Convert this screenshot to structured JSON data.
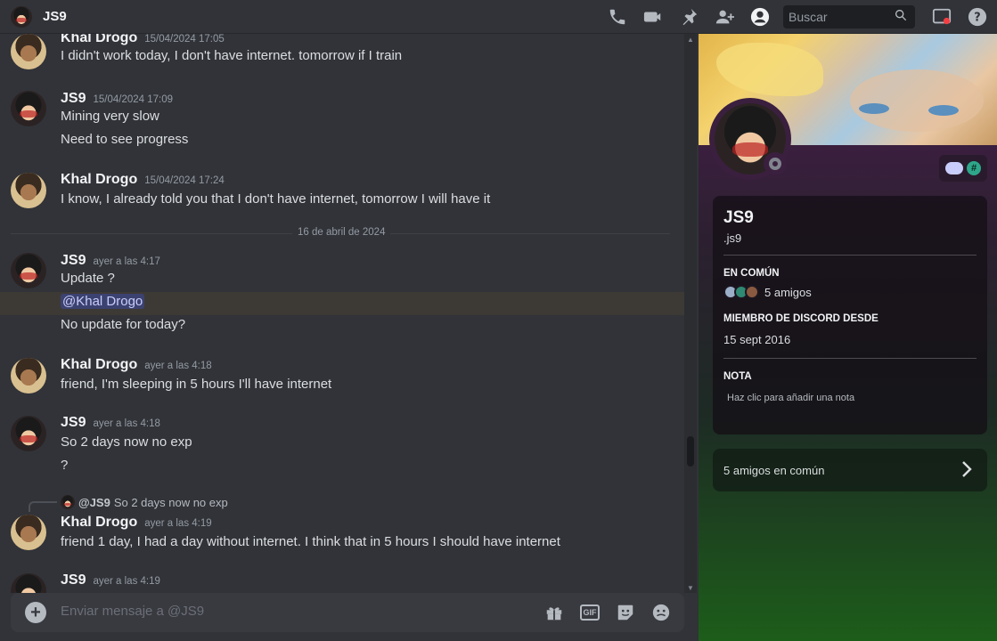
{
  "header": {
    "title": "JS9",
    "search_placeholder": "Buscar"
  },
  "messages": [
    {
      "author": "Khal Drogo",
      "time": "15/04/2024 17:05",
      "lines": [
        "I didn't work today, I don't have internet. tomorrow if I train"
      ]
    },
    {
      "author": "JS9",
      "time": "15/04/2024 17:09",
      "lines": [
        "Mining very slow",
        "Need to see progress"
      ]
    },
    {
      "author": "Khal Drogo",
      "time": "15/04/2024 17:24",
      "lines": [
        "I know, I already told you that I don't have internet, tomorrow I will have it"
      ]
    },
    {
      "author": "JS9",
      "time": "ayer a las 4:17",
      "lines": [
        "Update ?",
        "@Khal Drogo",
        "No update for today?"
      ]
    },
    {
      "author": "Khal Drogo",
      "time": "ayer a las 4:18",
      "lines": [
        "friend, I'm sleeping in 5 hours I'll have internet"
      ]
    },
    {
      "author": "JS9",
      "time": "ayer a las 4:18",
      "lines": [
        "So 2 days now no exp",
        "?"
      ]
    },
    {
      "author": "Khal Drogo",
      "time": "ayer a las 4:19",
      "reply_author": "@JS9",
      "reply_text": "So 2 days now no exp",
      "lines": [
        "friend 1 day, I had a day without internet. I think that in 5 hours I should have internet"
      ]
    },
    {
      "author": "JS9",
      "time": "ayer a las 4:19",
      "lines": []
    }
  ],
  "date_divider": "16 de abril de 2024",
  "composer": {
    "placeholder": "Enviar mensaje a @JS9",
    "gif_label": "GIF"
  },
  "profile": {
    "display_name": "JS9",
    "username": ".js9",
    "badge_hash": "#",
    "in_common_title": "EN COMÚN",
    "in_common_text": "5 amigos",
    "member_since_title": "MIEMBRO DE DISCORD DESDE",
    "member_since_date": "15 sept 2016",
    "note_title": "NOTA",
    "note_placeholder": "Haz clic para añadir una nota",
    "mutual_friends_label": "5 amigos en común"
  },
  "colors": {
    "accent_mention_bg": "#3c4270",
    "highlight_row": "#3d3a36",
    "profile_top": "#3b1f3f",
    "profile_bottom": "#1d5d1a"
  },
  "icons": [
    "call-icon",
    "video-icon",
    "pin-icon",
    "add-friend-icon",
    "profile-icon",
    "search-icon",
    "inbox-icon",
    "help-icon",
    "plus-icon",
    "gift-icon",
    "gif-icon",
    "sticker-icon",
    "emoji-icon",
    "chevron-right-icon"
  ]
}
